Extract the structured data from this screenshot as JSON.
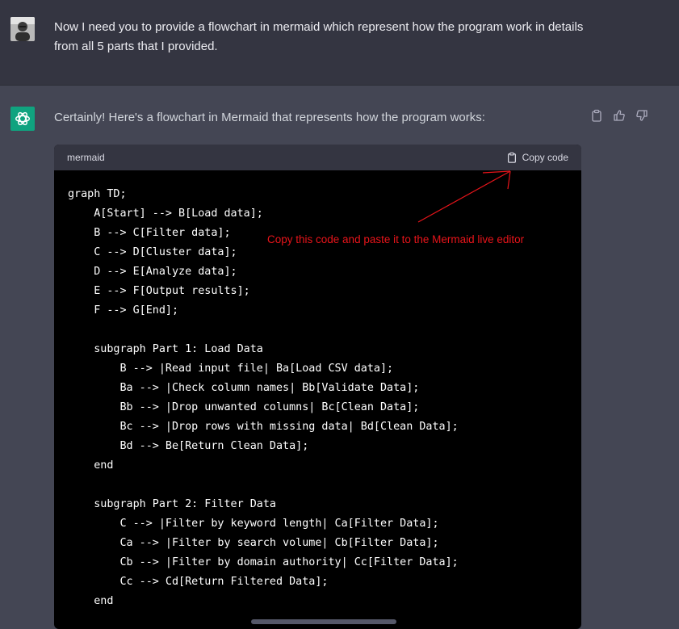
{
  "user_message": {
    "text": "Now I need you to provide a flowchart in mermaid which represent how the program work in details from all 5 parts that I provided."
  },
  "assistant_message": {
    "intro": "Certainly! Here's a flowchart in Mermaid that represents how the program works:"
  },
  "code_block": {
    "language": "mermaid",
    "copy_label": "Copy code",
    "lines": [
      "graph TD;",
      "    A[Start] --> B[Load data];",
      "    B --> C[Filter data];",
      "    C --> D[Cluster data];",
      "    D --> E[Analyze data];",
      "    E --> F[Output results];",
      "    F --> G[End];",
      "",
      "    subgraph Part 1: Load Data",
      "        B --> |Read input file| Ba[Load CSV data];",
      "        Ba --> |Check column names| Bb[Validate Data];",
      "        Bb --> |Drop unwanted columns| Bc[Clean Data];",
      "        Bc --> |Drop rows with missing data| Bd[Clean Data];",
      "        Bd --> Be[Return Clean Data];",
      "    end",
      "",
      "    subgraph Part 2: Filter Data",
      "        C --> |Filter by keyword length| Ca[Filter Data];",
      "        Ca --> |Filter by search volume| Cb[Filter Data];",
      "        Cb --> |Filter by domain authority| Cc[Filter Data];",
      "        Cc --> Cd[Return Filtered Data];",
      "    end"
    ]
  },
  "annotation": {
    "text": "Copy this code and paste it to the Mermaid live editor",
    "color": "#e8141a"
  },
  "icons": [
    "user-avatar",
    "chatgpt-logo",
    "clipboard-icon",
    "thumbs-up-icon",
    "thumbs-down-icon",
    "copy-icon"
  ]
}
